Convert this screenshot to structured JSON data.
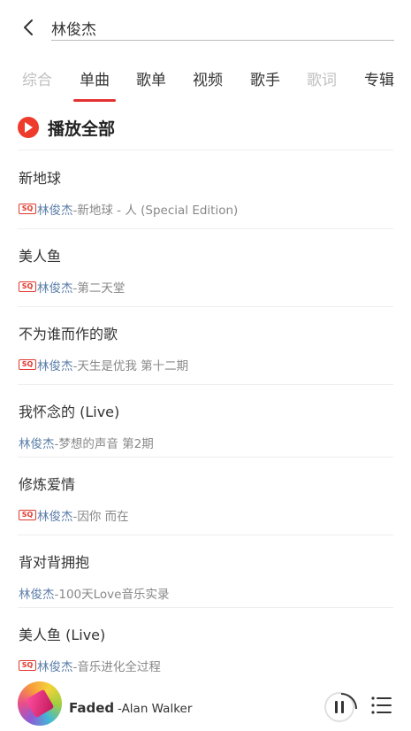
{
  "search": {
    "query": "林俊杰"
  },
  "tabs": [
    {
      "label": "综合",
      "state": "disabled"
    },
    {
      "label": "单曲",
      "state": "active"
    },
    {
      "label": "歌单",
      "state": "normal"
    },
    {
      "label": "视频",
      "state": "normal"
    },
    {
      "label": "歌手",
      "state": "normal"
    },
    {
      "label": "歌词",
      "state": "disabled"
    },
    {
      "label": "专辑",
      "state": "normal"
    }
  ],
  "play_all": {
    "label": "播放全部"
  },
  "songs": [
    {
      "title": "新地球",
      "sq": true,
      "artist": "林俊杰",
      "album": "-新地球 - 人 (Special Edition)"
    },
    {
      "title": "美人鱼",
      "sq": true,
      "artist": "林俊杰",
      "album": "-第二天堂"
    },
    {
      "title": "不为谁而作的歌",
      "sq": true,
      "artist": "林俊杰",
      "album": "-天生是优我 第十二期"
    },
    {
      "title": "我怀念的 (Live)",
      "sq": false,
      "artist": "林俊杰",
      "album": "-梦想的声音 第2期"
    },
    {
      "title": "修炼爱情",
      "sq": true,
      "artist": "林俊杰",
      "album": "-因你 而在"
    },
    {
      "title": "背对背拥抱",
      "sq": false,
      "artist": "林俊杰",
      "album": "-100天Love音乐实录"
    },
    {
      "title": "美人鱼 (Live)",
      "sq": true,
      "artist": "林俊杰",
      "album": "-音乐进化全过程"
    }
  ],
  "sq_badge": "SQ",
  "player": {
    "title": "Faded",
    "artist": "-Alan Walker",
    "state": "playing"
  },
  "colors": {
    "accent": "#e33131",
    "artist_link": "#5b7ea8",
    "muted": "#888888",
    "disabled_tab": "#bfbfbf"
  }
}
